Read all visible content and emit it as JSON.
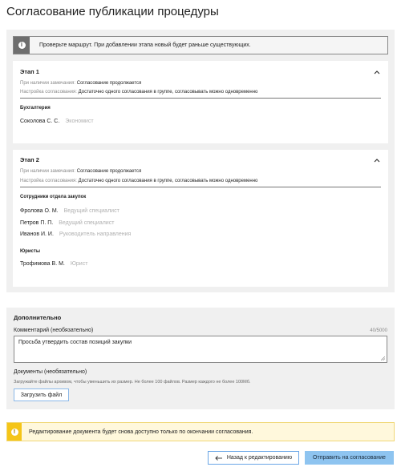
{
  "page": {
    "title": "Согласование публикации процедуры"
  },
  "route": {
    "info_banner": {
      "icon": "info-icon",
      "text": "Проверьте маршрут. При добавлении этапа новый будет раньше существующих."
    },
    "stages": [
      {
        "title": "Этап 1",
        "on_remark_label": "При наличии замечания:",
        "on_remark_value": "Согласование продолжается",
        "setting_label": "Настройка согласования:",
        "setting_value": "Достаточно одного согласования в группе, согласовывать можно одновременно",
        "groups": [
          {
            "name": "Бухгалтерия",
            "members": [
              {
                "name": "Соколова С. С.",
                "role": "Экономист"
              }
            ]
          }
        ]
      },
      {
        "title": "Этап 2",
        "on_remark_label": "При наличии замечания:",
        "on_remark_value": "Согласование продолжается",
        "setting_label": "Настройка согласования:",
        "setting_value": "Достаточно одного согласования в группе, согласовывать можно одновременно",
        "groups": [
          {
            "name": "Сотрудники отдела закупок",
            "members": [
              {
                "name": "Фролова О. М.",
                "role": "Ведущий специалист"
              },
              {
                "name": "Петров П. П.",
                "role": "Ведущий специалист"
              },
              {
                "name": "Иванов И. И.",
                "role": "Руководитель направления"
              }
            ]
          },
          {
            "name": "Юристы",
            "members": [
              {
                "name": "Трофимова В. М.",
                "role": "Юрист"
              }
            ]
          }
        ]
      }
    ]
  },
  "extra": {
    "title": "Дополнительно",
    "comment_label": "Комментарий (необязательно)",
    "comment_counter": "40/5000",
    "comment_value": "Просьба утвердить состав позиций закупки",
    "docs_label": "Документы (необязательно)",
    "docs_hint": "Загружайте файлы архивом, чтобы уменьшить их размер. Не более 100 файлов. Размер каждого не более 100Мб.",
    "upload_label": "Загрузить файл"
  },
  "warning": {
    "icon": "warning-icon",
    "text": "Редактирование документа будет снова доступно только по окончании согласования."
  },
  "actions": {
    "back_label": "Назад к редактированию",
    "submit_label": "Отправить на согласование"
  },
  "colors": {
    "panel_bg": "#f0f0f0",
    "accent_blue": "#8ec4f0",
    "warning_yellow": "#f5c518",
    "info_gray": "#6e6e6e"
  }
}
